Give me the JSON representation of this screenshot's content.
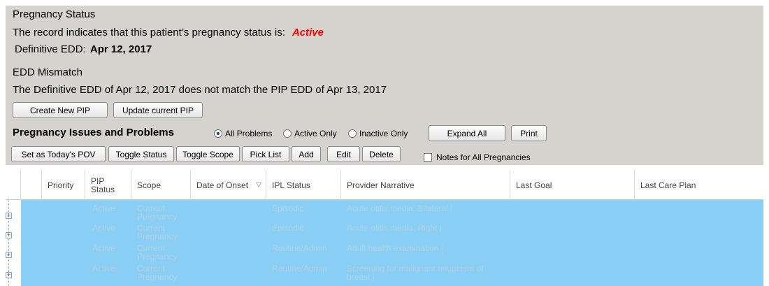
{
  "pregnancy_status": {
    "section_title": "Pregnancy Status",
    "status_text": "The record indicates that this patient’s pregnancy status is:",
    "status_value": "Active",
    "edd_label": "Definitive EDD:",
    "edd_value": "Apr 12, 2017"
  },
  "edd_mismatch": {
    "section_title": "EDD Mismatch",
    "message": "The Definitive EDD of Apr 12, 2017 does not match the PIP EDD of Apr 13, 2017",
    "create_button": "Create New PIP",
    "update_button": "Update current PIP"
  },
  "issues": {
    "title": "Pregnancy Issues and Problems",
    "filters": [
      {
        "label": "All Problems",
        "selected": true
      },
      {
        "label": "Active Only",
        "selected": false
      },
      {
        "label": "Inactive Only",
        "selected": false
      }
    ],
    "expand_all": "Expand All",
    "print": "Print",
    "toolbar": {
      "set_pov": "Set as Today's POV",
      "toggle_status": "Toggle Status",
      "toggle_scope": "Toggle Scope",
      "pick_list": "Pick List",
      "add": "Add",
      "edit": "Edit",
      "delete": "Delete"
    },
    "notes_checkbox": {
      "label": "Notes for All Pregnancies",
      "checked": false
    }
  },
  "grid": {
    "columns": [
      "Priority",
      "PIP\nStatus",
      "Scope",
      "Date of Onset",
      "IPL Status",
      "Provider Narrative",
      "Last Goal",
      "Last Care Plan"
    ],
    "sorted_column": "Date of Onset",
    "rows": [
      {
        "priority": "",
        "pip_status": "Active",
        "scope": "Current\nPregnancy",
        "date_of_onset": "",
        "ipl_status": "Episodic",
        "narrative": "Acute otitis media, Bilateral |",
        "last_goal": "",
        "last_care_plan": ""
      },
      {
        "priority": "",
        "pip_status": "Active",
        "scope": "Current\nPregnancy",
        "date_of_onset": "",
        "ipl_status": "Episodic",
        "narrative": "Acute otitis media, Right |",
        "last_goal": "",
        "last_care_plan": ""
      },
      {
        "priority": "",
        "pip_status": "Active",
        "scope": "Current\nPregnancy",
        "date_of_onset": "",
        "ipl_status": "Routine/Admin",
        "narrative": "Adult health examination |",
        "last_goal": "",
        "last_care_plan": ""
      },
      {
        "priority": "",
        "pip_status": "Active",
        "scope": "Current\nPregnancy",
        "date_of_onset": "",
        "ipl_status": "Routine/Admin",
        "narrative": "Screening for malignant neoplasm of\nbreast |",
        "last_goal": "",
        "last_care_plan": ""
      }
    ]
  },
  "colors": {
    "panel_bg": "#d6d3ce",
    "selected_row_bg": "#8acff5",
    "active_status": "#ff0000"
  }
}
